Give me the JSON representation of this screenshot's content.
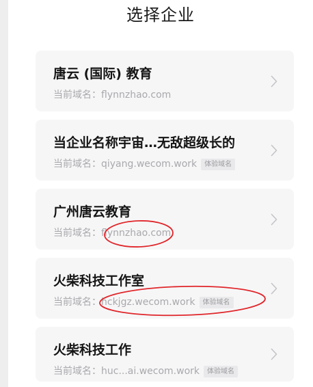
{
  "header": {
    "title": "选择企业"
  },
  "companies": [
    {
      "name": "唐云 (国际) 教育",
      "domain_label": "当前域名：",
      "domain": "flynnzhao.com",
      "tag": ""
    },
    {
      "name": "当企业名称宇宙…无敌超级长的",
      "domain_label": "当前域名：",
      "domain": "qiyang.wecom.work",
      "tag": "体验域名"
    },
    {
      "name": "广州唐云教育",
      "domain_label": "当前域名：",
      "domain": "flynnzhao.com",
      "tag": ""
    },
    {
      "name": "火柴科技工作室",
      "domain_label": "当前域名：",
      "domain": "hckjgz.wecom.work",
      "tag": "体验域名"
    },
    {
      "name": "火柴科技工作",
      "domain_label": "当前域名：",
      "domain": "huc...ai.wecom.work",
      "tag": "体验域名"
    }
  ],
  "icons": {
    "row_arrow": "chevron-right-icon"
  },
  "colors": {
    "card_background": "#f6f6f7",
    "annotation_red": "#e0262a"
  }
}
